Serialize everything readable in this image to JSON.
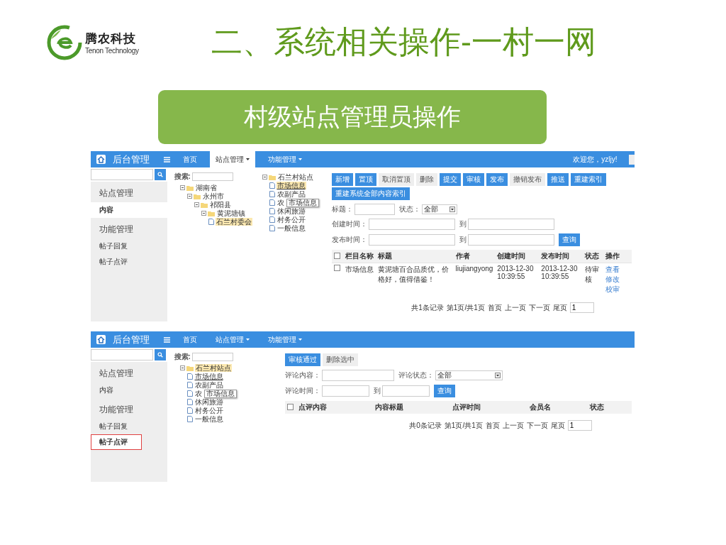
{
  "header": {
    "logo": {
      "name": "腾农科技",
      "tagline": "Tenon Technology"
    },
    "title": "二、系统相关操作-一村一网"
  },
  "banner": "村级站点管理员操作",
  "screens": [
    {
      "brand": "后台管理",
      "nav": [
        {
          "label": "首页",
          "dropdown": false,
          "selected": false
        },
        {
          "label": "站点管理",
          "dropdown": true,
          "selected": true
        },
        {
          "label": "功能管理",
          "dropdown": true,
          "selected": false
        }
      ],
      "welcome": "欢迎您，yzljy!",
      "sidebar": [
        {
          "title": "站点管理",
          "items": [
            {
              "label": "内容",
              "selected": true,
              "highlighted": false
            }
          ]
        },
        {
          "title": "功能管理",
          "items": [
            {
              "label": "帖子回复",
              "selected": false,
              "highlighted": false
            },
            {
              "label": "帖子点评",
              "selected": false,
              "highlighted": false
            }
          ]
        }
      ],
      "trees": [
        {
          "search_label": "搜索:",
          "nodes": [
            {
              "label": "湖南省",
              "kind": "folder",
              "selected": false,
              "hovered": false,
              "children": [
                {
                  "label": "永州市",
                  "kind": "folder",
                  "selected": false,
                  "hovered": false,
                  "children": [
                    {
                      "label": "祁阳县",
                      "kind": "folder",
                      "selected": false,
                      "hovered": false,
                      "children": [
                        {
                          "label": "黄泥塘镇",
                          "kind": "folder",
                          "selected": false,
                          "hovered": false,
                          "children": [
                            {
                              "label": "石兰村委会",
                              "kind": "doc",
                              "selected": true,
                              "hovered": false
                            }
                          ]
                        }
                      ]
                    }
                  ]
                }
              ]
            }
          ]
        },
        {
          "nodes": [
            {
              "label": "石兰村站点",
              "kind": "folder",
              "selected": false,
              "hovered": false,
              "children": [
                {
                  "label": "市场信息",
                  "kind": "doc",
                  "selected": true,
                  "hovered": true
                },
                {
                  "label": "农副产品",
                  "kind": "doc",
                  "selected": false,
                  "hovered": false
                },
                {
                  "label": "农",
                  "kind": "doc",
                  "selected": false,
                  "hovered": false,
                  "tooltip": "市场信息"
                },
                {
                  "label": "休闲旅游",
                  "kind": "doc",
                  "selected": false,
                  "hovered": false
                },
                {
                  "label": "村务公开",
                  "kind": "doc",
                  "selected": false,
                  "hovered": false
                },
                {
                  "label": "一般信息",
                  "kind": "doc",
                  "selected": false,
                  "hovered": false
                }
              ]
            }
          ]
        }
      ],
      "toolbar": [
        {
          "label": "新增",
          "kind": "primary"
        },
        {
          "label": "置顶",
          "kind": "primary"
        },
        {
          "label": "取消置顶",
          "kind": "default"
        },
        {
          "label": "删除",
          "kind": "default"
        },
        {
          "label": "提交",
          "kind": "primary"
        },
        {
          "label": "审核",
          "kind": "primary"
        },
        {
          "label": "发布",
          "kind": "primary"
        },
        {
          "label": "撤销发布",
          "kind": "default"
        },
        {
          "label": "推送",
          "kind": "primary"
        },
        {
          "label": "重建索引",
          "kind": "primary"
        },
        {
          "label": "重建系统全部内容索引",
          "kind": "primary"
        }
      ],
      "filters": [
        [
          {
            "kind": "label",
            "text": "标题："
          },
          {
            "kind": "input",
            "wide": false
          },
          {
            "kind": "label",
            "text": "状态："
          },
          {
            "kind": "select",
            "value": "全部",
            "wide": false
          }
        ],
        [
          {
            "kind": "label",
            "text": "创建时间："
          },
          {
            "kind": "input",
            "wide": true
          },
          {
            "kind": "label",
            "text": "到"
          },
          {
            "kind": "input",
            "wide": true
          }
        ],
        [
          {
            "kind": "label",
            "text": "发布时间："
          },
          {
            "kind": "input",
            "wide": true
          },
          {
            "kind": "label",
            "text": "到"
          },
          {
            "kind": "input",
            "wide": true
          },
          {
            "kind": "button",
            "text": "查询"
          }
        ]
      ],
      "table": {
        "all_checked": false,
        "columns": [
          "栏目名称",
          "标题",
          "作者",
          "创建时间",
          "发布时间",
          "状态",
          "操作"
        ],
        "rows": [
          {
            "checked": false,
            "cells": [
              "市场信息",
              "黄泥塘百合品质优，价格好，值得借鉴！",
              "liujiangyong",
              "2013-12-30 10:39:55",
              "2013-12-30 10:39:55",
              "待审核"
            ],
            "actions": [
              "查看",
              "修改",
              "校审"
            ]
          }
        ]
      },
      "pagination": {
        "summary": "共1条记录",
        "pages": "第1页/共1页",
        "links": [
          "首页",
          "上一页",
          "下一页",
          "尾页"
        ],
        "page": "1"
      }
    },
    {
      "brand": "后台管理",
      "nav": [
        {
          "label": "首页",
          "dropdown": false,
          "selected": false
        },
        {
          "label": "站点管理",
          "dropdown": true,
          "selected": false
        },
        {
          "label": "功能管理",
          "dropdown": true,
          "selected": false
        }
      ],
      "sidebar": [
        {
          "title": "站点管理",
          "items": [
            {
              "label": "内容",
              "selected": false,
              "highlighted": false
            }
          ]
        },
        {
          "title": "功能管理",
          "items": [
            {
              "label": "帖子回复",
              "selected": false,
              "highlighted": false
            },
            {
              "label": "帖子点评",
              "selected": true,
              "highlighted": true
            }
          ]
        }
      ],
      "trees": [
        {
          "search_label": "搜索:",
          "nodes": [
            {
              "label": "石兰村站点",
              "kind": "folder",
              "selected": true,
              "hovered": false,
              "children": [
                {
                  "label": "市场信息",
                  "kind": "doc",
                  "selected": false,
                  "hovered": true
                },
                {
                  "label": "农副产品",
                  "kind": "doc",
                  "selected": false,
                  "hovered": false
                },
                {
                  "label": "农",
                  "kind": "doc",
                  "selected": false,
                  "hovered": false,
                  "tooltip": "市场信息"
                },
                {
                  "label": "休闲旅游",
                  "kind": "doc",
                  "selected": false,
                  "hovered": false
                },
                {
                  "label": "村务公开",
                  "kind": "doc",
                  "selected": false,
                  "hovered": false
                },
                {
                  "label": "一般信息",
                  "kind": "doc",
                  "selected": false,
                  "hovered": false
                }
              ]
            }
          ]
        }
      ],
      "toolbar": [
        {
          "label": "审核通过",
          "kind": "primary"
        },
        {
          "label": "删除选中",
          "kind": "default"
        }
      ],
      "filters": [
        [
          {
            "kind": "label",
            "text": "评论内容："
          },
          {
            "kind": "input",
            "wide": true
          },
          {
            "kind": "label",
            "text": "评论状态："
          },
          {
            "kind": "select",
            "value": "全部",
            "wide": true
          }
        ],
        [
          {
            "kind": "label",
            "text": "评论时间："
          },
          {
            "kind": "input",
            "wide": false
          },
          {
            "kind": "label",
            "text": "到"
          },
          {
            "kind": "input",
            "wide": false
          },
          {
            "kind": "button",
            "text": "查询"
          }
        ]
      ],
      "table": {
        "all_checked": false,
        "columns": [
          "点评内容",
          "内容标题",
          "点评时间",
          "会员名",
          "状态"
        ]
      },
      "pagination": {
        "summary": "共0条记录",
        "pages": "第1页/共1页",
        "links": [
          "首页",
          "上一页",
          "下一页",
          "尾页"
        ],
        "page": "1"
      }
    }
  ]
}
